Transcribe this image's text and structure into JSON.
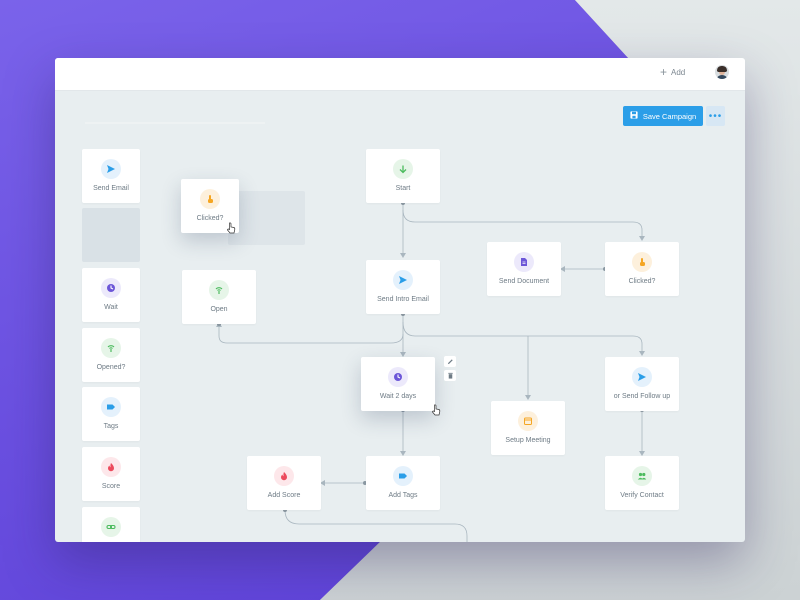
{
  "topbar": {
    "add_label": "Add",
    "add_icon": "plus-icon",
    "avatar_icon": "user-avatar"
  },
  "toolbar": {
    "save_label": "Save Campaign",
    "save_icon": "save-icon",
    "more_icon": "more-icon",
    "accent_color": "#2b9ee8"
  },
  "palette": {
    "items": [
      {
        "label": "Send Email",
        "icon": "send-icon"
      },
      {
        "label": "Wait",
        "icon": "clock-icon"
      },
      {
        "label": "Opened?",
        "icon": "signal-icon"
      },
      {
        "label": "Tags",
        "icon": "tag-icon"
      },
      {
        "label": "Score",
        "icon": "flame-icon"
      },
      {
        "label": "",
        "icon": "link-icon"
      }
    ]
  },
  "drag": {
    "label": "Clicked?",
    "icon": "pointer-hand-icon"
  },
  "nodes": {
    "start": {
      "label": "Start",
      "icon": "arrow-down-icon"
    },
    "send_intro": {
      "label": "Send Intro Email",
      "icon": "send-icon"
    },
    "open": {
      "label": "Open",
      "icon": "signal-icon"
    },
    "send_document": {
      "label": "Send Document",
      "icon": "document-icon"
    },
    "clicked": {
      "label": "Clicked?",
      "icon": "pointer-hand-icon"
    },
    "wait": {
      "label": "Wait 2 days",
      "icon": "clock-icon"
    },
    "setup_meeting": {
      "label": "Setup Meeting",
      "icon": "calendar-icon"
    },
    "follow_up": {
      "label": "or Send Follow up",
      "icon": "send-icon"
    },
    "add_score": {
      "label": "Add Score",
      "icon": "flame-icon"
    },
    "add_tags": {
      "label": "Add Tags",
      "icon": "tag-icon"
    },
    "verify_contact": {
      "label": "Verify Contact",
      "icon": "users-icon"
    }
  },
  "colors": {
    "blue": "#2b9ee8",
    "green": "#4cbb5e",
    "orange": "#f5a623",
    "purple": "#6c56d8",
    "red": "#ec4a5c",
    "connector": "#a9b6bf"
  }
}
